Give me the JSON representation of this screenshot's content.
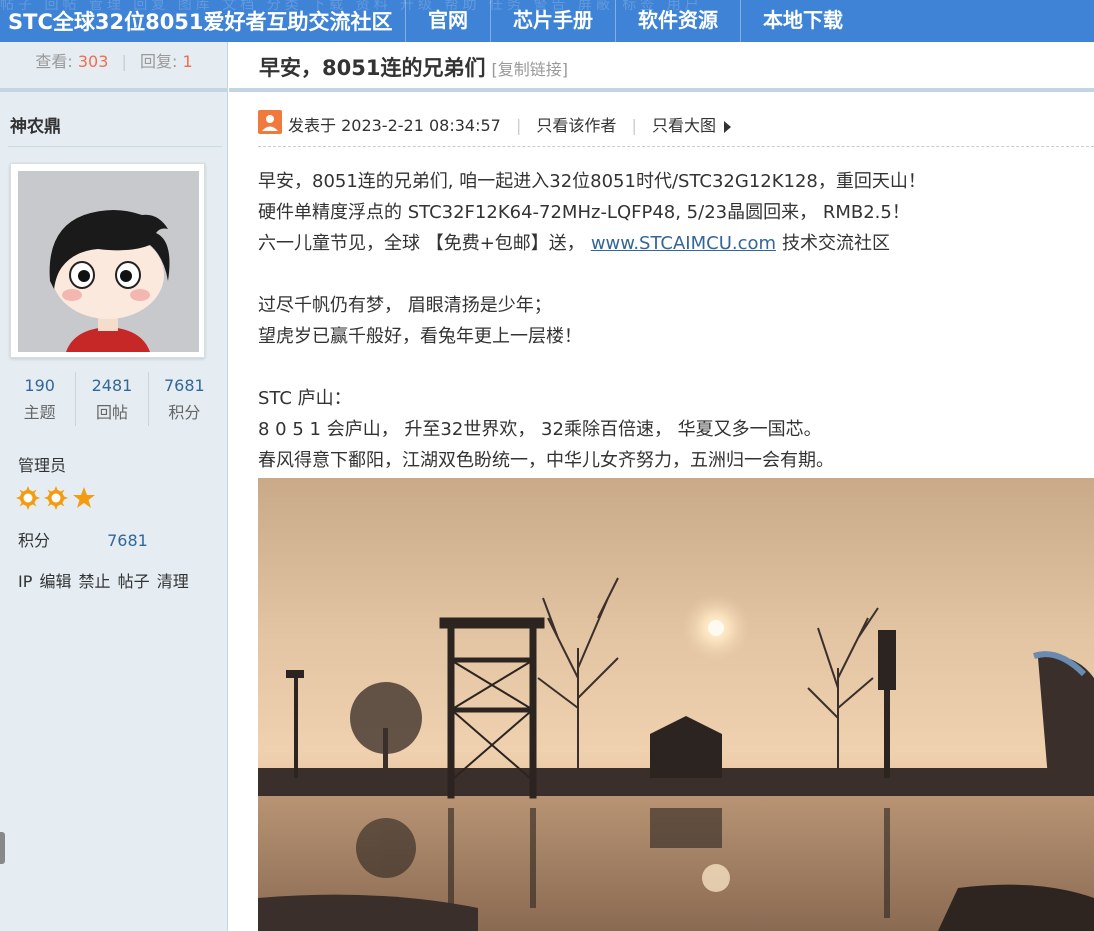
{
  "nav": {
    "site_title": "STC全球32位8051爱好者互助交流社区",
    "ghost_text": "帖子  回帖  管理  回复  图库  文档  分类  下载  资料  升级  帮助  任务  警告  屏蔽  标签  用户",
    "items": [
      "官网",
      "芯片手册",
      "软件资源",
      "本地下载"
    ]
  },
  "stats": {
    "views_label": "查看:",
    "views": "303",
    "replies_label": "回复:",
    "replies": "1"
  },
  "author": {
    "name": "神农鼎",
    "stats": [
      {
        "value": "190",
        "label": "主题"
      },
      {
        "value": "2481",
        "label": "回帖"
      },
      {
        "value": "7681",
        "label": "积分"
      }
    ],
    "role": "管理员",
    "score_label": "积分",
    "score_value": "7681",
    "admin_links": "IP 编辑 禁止 帖子 清理",
    "stars": {
      "suns": 2,
      "stars": 1
    }
  },
  "thread": {
    "title": "早安，8051连的兄弟们",
    "copy_link": "[复制链接]"
  },
  "post": {
    "posted": "发表于 2023-2-21 08:34:57",
    "only_author": "只看该作者",
    "only_big_image": "只看大图",
    "lines": [
      "早安，8051连的兄弟们, 咱一起进入32位8051时代/STC32G12K128，重回天山！",
      "硬件单精度浮点的 STC32F12K64-72MHz-LQFP48, 5/23晶圆回来， RMB2.5！"
    ],
    "line3_pre": "六一儿童节见，全球 【免费+包邮】送，",
    "line3_link": "www.STCAIMCU.com",
    "line3_post": "技术交流社区",
    "poem1": [
      "过尽千帆仍有梦，   眉眼清扬是少年；",
      "望虎岁已赢千般好，看兔年更上一层楼！"
    ],
    "poem2": [
      "STC 庐山：",
      "8 0 5 1 会庐山，   升至32世界欢，    32乘除百倍速，    华夏又多一国芯。",
      "春风得意下鄱阳，江湖双色盼统一，中华儿女齐努力，五洲归一会有期。"
    ]
  },
  "colors": {
    "nav_bg": "#3f83d6",
    "sidebar_bg": "#e5edf2",
    "accent_number": "#f26c4f",
    "link": "#336699",
    "star": "#f39c12"
  }
}
